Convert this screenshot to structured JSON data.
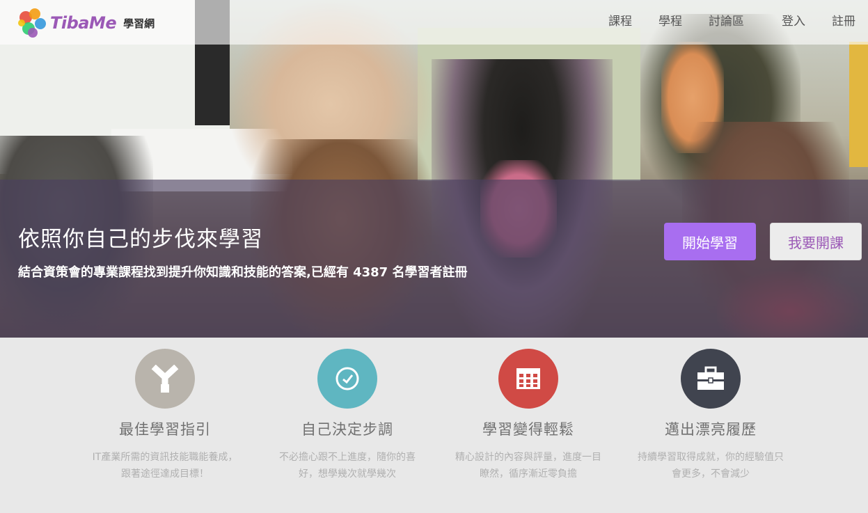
{
  "brand": {
    "logo_text": "TibaMe",
    "subtitle": "學習網",
    "colors": {
      "logo": "#9b59b6",
      "accent": "#a86ef0"
    }
  },
  "nav": {
    "items": [
      {
        "label": "課程"
      },
      {
        "label": "學程"
      },
      {
        "label": "討論區"
      },
      {
        "label": "登入"
      },
      {
        "label": "註冊"
      }
    ]
  },
  "hero": {
    "title": "依照你自己的步伐來學習",
    "subtitle": "結合資策會的專業課程找到提升你知識和技能的答案,已經有 4387 名學習者註冊",
    "start_button": "開始學習",
    "teach_button": "我要開課"
  },
  "features": [
    {
      "icon": "signpost-icon",
      "color": "#b9b4ac",
      "title": "最佳學習指引",
      "desc": "IT產業所需的資訊技能職能養成，跟著途徑達成目標！"
    },
    {
      "icon": "clock-icon",
      "color": "#5fb6c1",
      "title": "自己決定步調",
      "desc": "不必擔心跟不上進度，隨你的喜好，想學幾次就學幾次"
    },
    {
      "icon": "calendar-icon",
      "color": "#d04a45",
      "title": "學習變得輕鬆",
      "desc": "精心設計的內容與評量，進度一目瞭然，循序漸近零負擔"
    },
    {
      "icon": "briefcase-icon",
      "color": "#40444f",
      "title": "邁出漂亮履歷",
      "desc": "持續學習取得成就，你的經驗值只會更多，不會減少"
    }
  ]
}
